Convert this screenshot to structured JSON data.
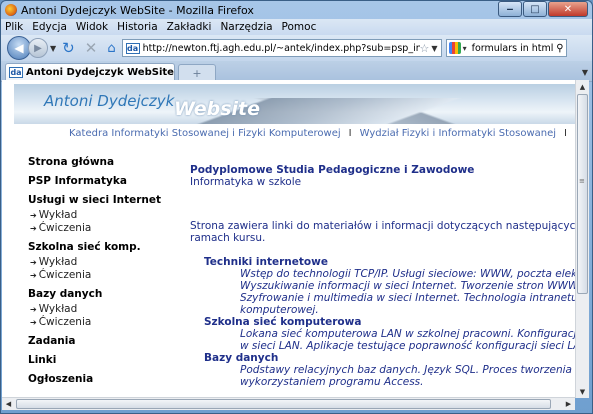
{
  "window": {
    "title": "Antoni Dydejczyk WebSite - Mozilla Firefox"
  },
  "menu": [
    "Plik",
    "Edycja",
    "Widok",
    "Historia",
    "Zakładki",
    "Narzędzia",
    "Pomoc"
  ],
  "nav": {
    "url": "http://newton.ftj.agh.edu.pl/~antek/index.php?sub=psp_inf",
    "search_value": "formulars in html",
    "favicon_text": "da"
  },
  "tabs": [
    {
      "label": "Antoni Dydejczyk WebSite"
    }
  ],
  "banner": {
    "name": "Antoni Dydejczyk",
    "word": "Website"
  },
  "dept_links": [
    "Katedra Informatyki Stosowanej i Fizyki Komputerowej",
    "Wydział Fizyki i Informatyki Stosowanej"
  ],
  "dept_sep": "I",
  "sidebar": {
    "items": [
      {
        "label": "Strona główna",
        "subs": []
      },
      {
        "label": "PSP Informatyka",
        "subs": []
      },
      {
        "label": "Usługi w sieci Internet",
        "subs": [
          "Wykład",
          "Ćwiczenia"
        ]
      },
      {
        "label": "Szkolna sieć komp.",
        "subs": [
          "Wykład",
          "Ćwiczenia"
        ]
      },
      {
        "label": "Bazy danych",
        "subs": [
          "Wykład",
          "Ćwiczenia"
        ]
      },
      {
        "label": "Zadania",
        "subs": []
      },
      {
        "label": "Linki",
        "subs": []
      },
      {
        "label": "Ogłoszenia",
        "subs": []
      }
    ]
  },
  "main": {
    "heading": "Podyplomowe Studia Pedagogiczne i Zawodowe",
    "subheading": "Informatyka w szkole",
    "intro": [
      "Strona zawiera linki do materiałów i informacji dotyczących następujących zajęć",
      "ramach kursu."
    ],
    "sections": [
      {
        "title": "Techniki internetowe",
        "lines": [
          "Wstęp do technologii TCP/IP. Usługi sieciowe: WWW, poczta elektronic",
          "Wyszukiwanie informacji w sieci Internet. Tworzenie stron WWW. Języ",
          "Szyfrowanie i multimedia w sieci Internet. Technologia intranetu w sz",
          "komputerowej."
        ]
      },
      {
        "title": "Szkolna sieć komputerowa",
        "lines": [
          "Lokana sieć komputerowa LAN w szkolnej pracowni. Konfiguracja syst",
          "w sieci LAN. Aplikacje testujące poprawność konfiguracji sieci LAN."
        ]
      },
      {
        "title": "Bazy danych",
        "lines": [
          "Podstawy relacyjnych baz danych. Język SQL. Proces tworzenia aplika",
          "wykorzystaniem programu Access."
        ]
      }
    ]
  }
}
